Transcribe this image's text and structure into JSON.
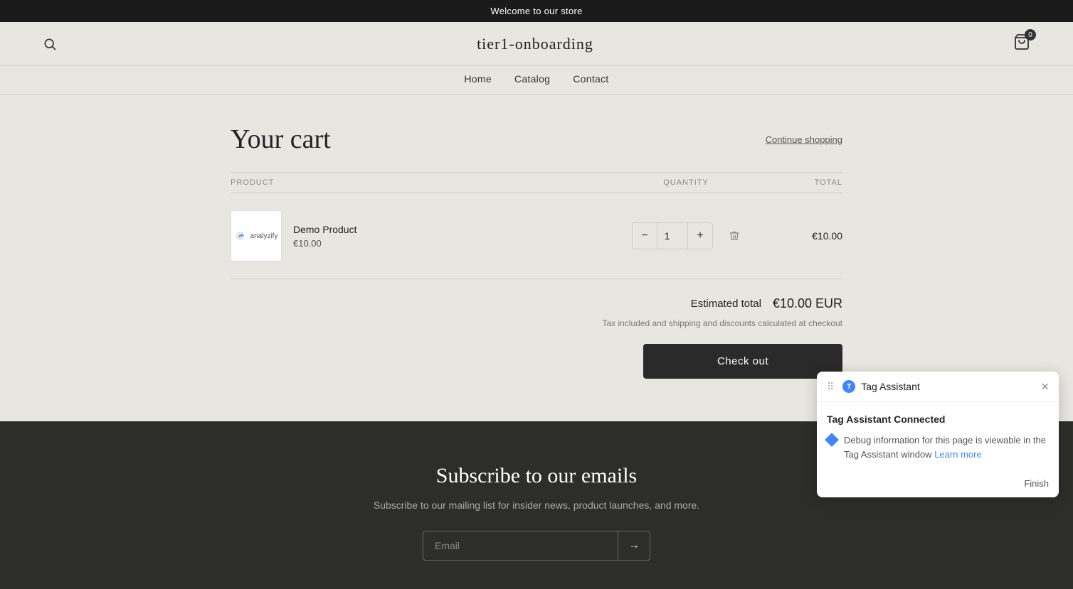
{
  "banner": {
    "text": "Welcome to our store"
  },
  "header": {
    "store_name": "tier1-onboarding",
    "cart_count": "0"
  },
  "nav": {
    "items": [
      {
        "label": "Home",
        "href": "#"
      },
      {
        "label": "Catalog",
        "href": "#"
      },
      {
        "label": "Contact",
        "href": "#"
      }
    ]
  },
  "cart": {
    "title": "Your cart",
    "continue_shopping": "Continue shopping",
    "columns": {
      "product": "PRODUCT",
      "quantity": "QUANTITY",
      "total": "TOTAL"
    },
    "items": [
      {
        "name": "Demo Product",
        "price": "€10.00",
        "quantity": 1,
        "total": "€10.00"
      }
    ],
    "estimated_total_label": "Estimated total",
    "estimated_total_value": "€10.00 EUR",
    "tax_note": "Tax included and shipping and discounts calculated at checkout",
    "checkout_label": "Check out"
  },
  "footer": {
    "title": "Subscribe to our emails",
    "subtitle": "Subscribe to our mailing list for insider news, product launches, and more.",
    "email_placeholder": "Email"
  },
  "tag_assistant": {
    "title": "Tag Assistant",
    "connected_text": "Tag Assistant Connected",
    "debug_text": "Debug information for this page is viewable in the Tag Assistant window",
    "learn_more_text": "Learn more",
    "finish_label": "Finish"
  }
}
